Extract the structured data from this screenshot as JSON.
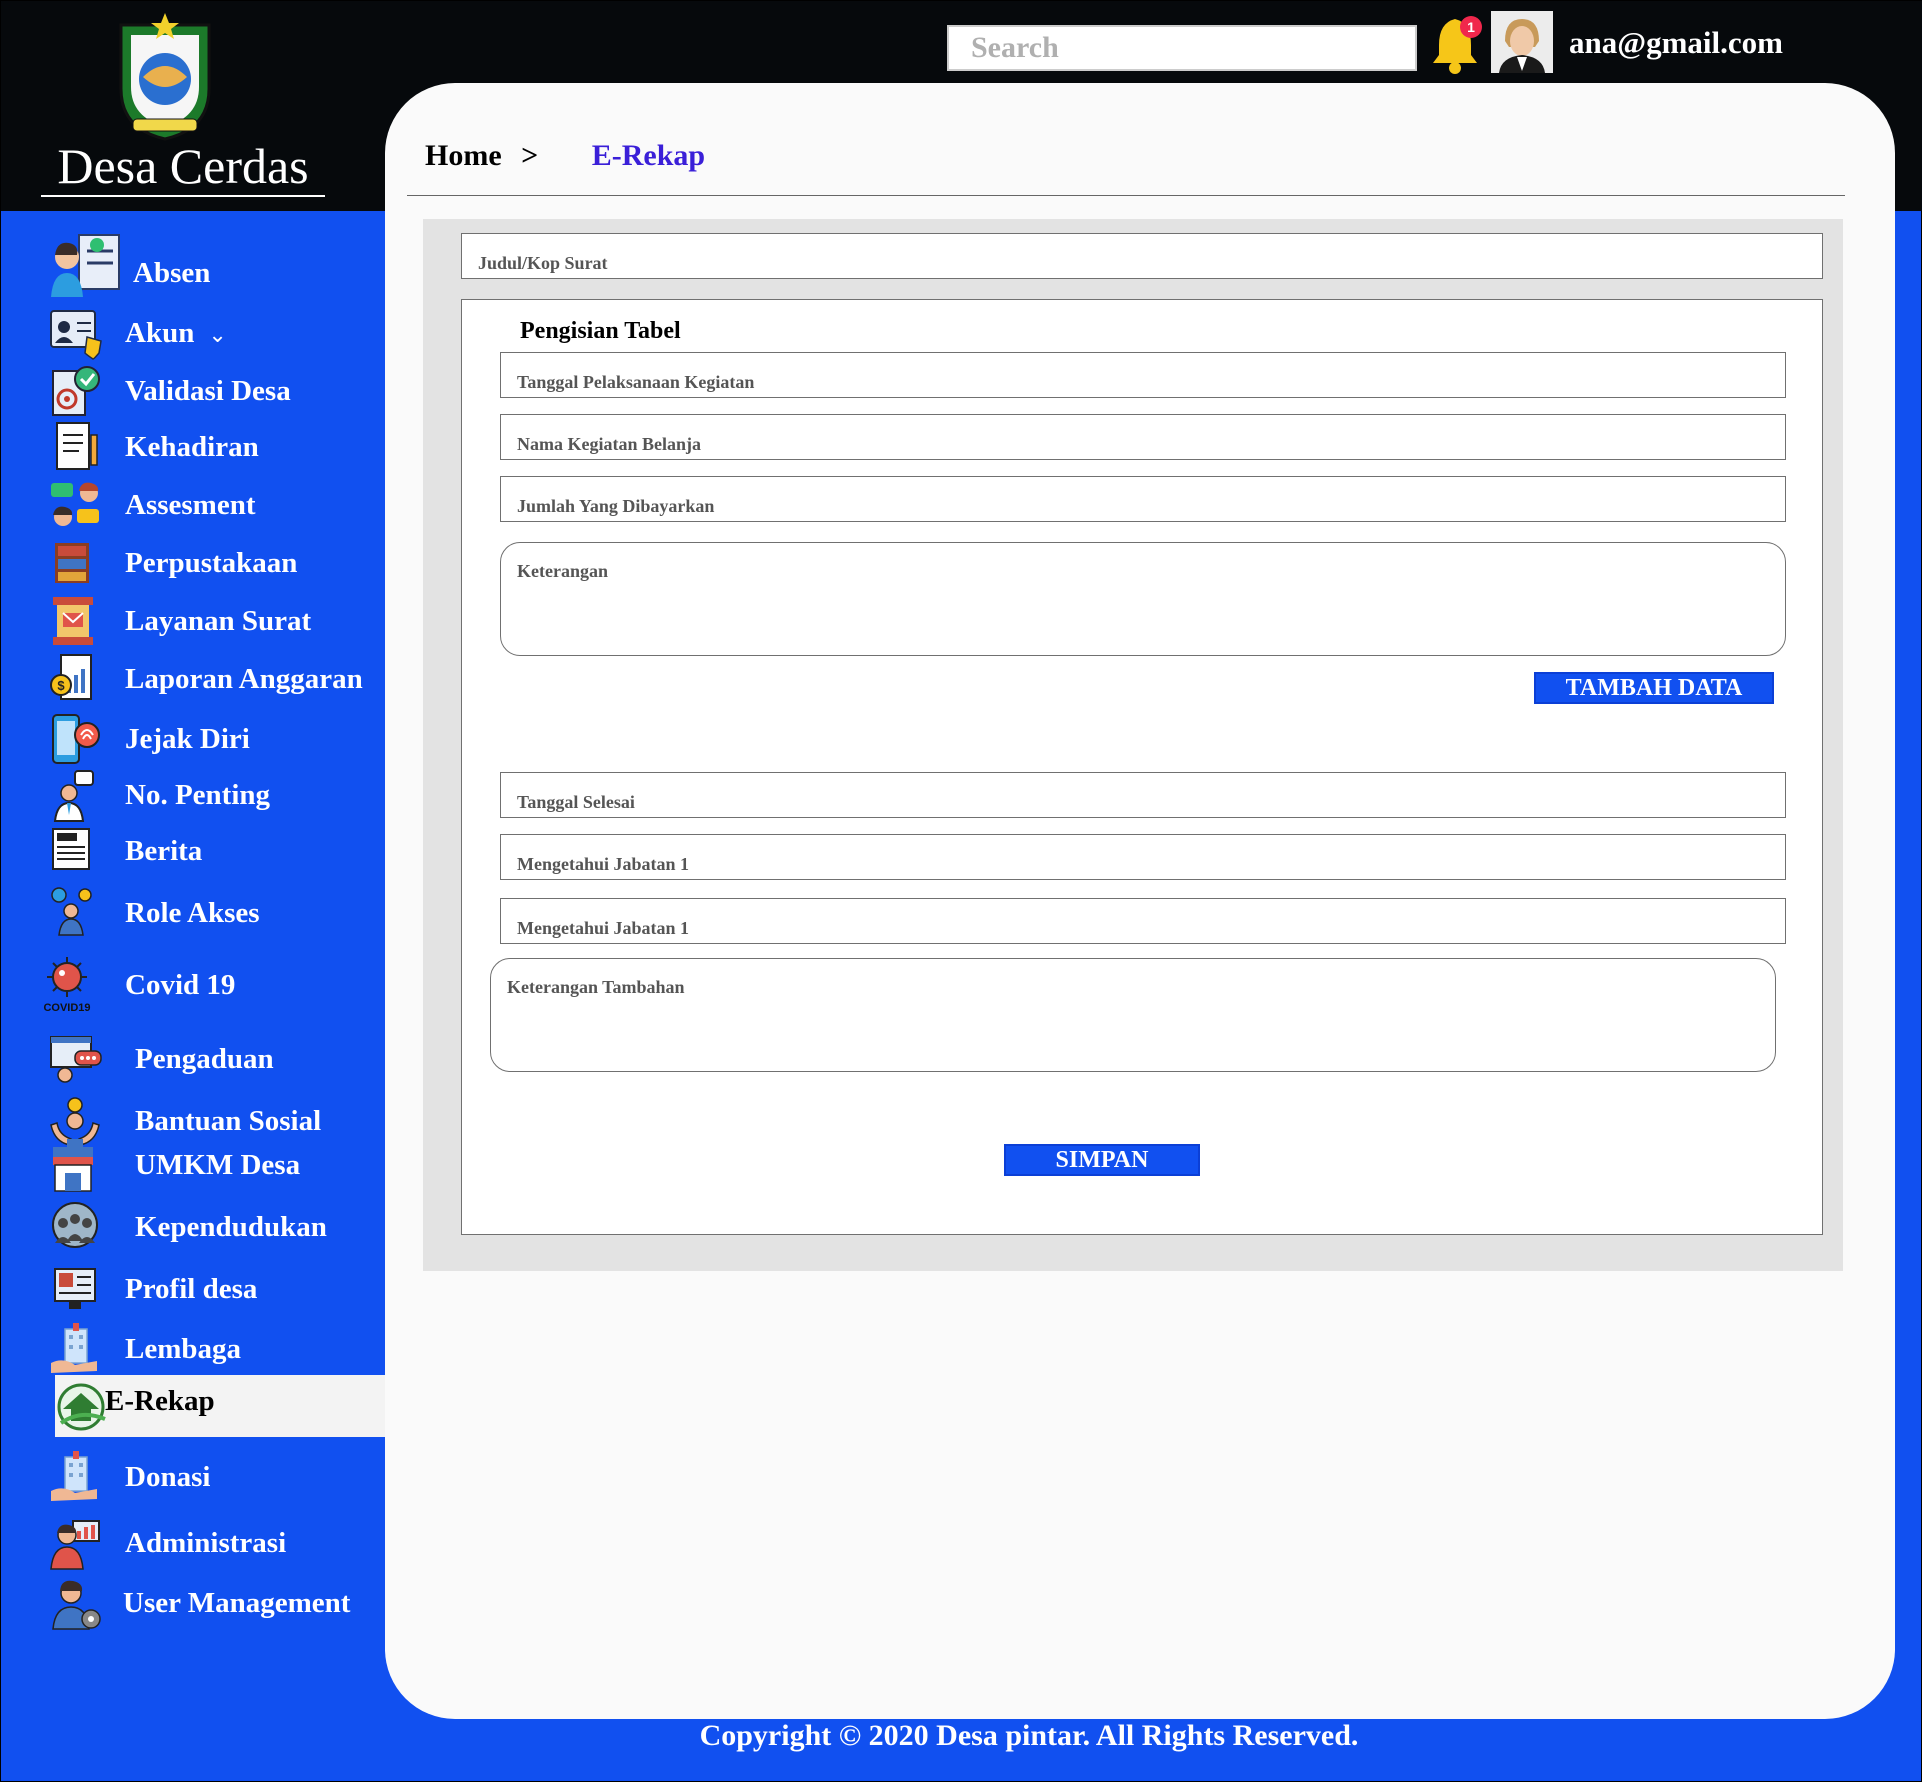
{
  "header": {
    "brand": "Desa Cerdas",
    "search_placeholder": "Search",
    "notification_count": "1",
    "user_email": "ana@gmail.com"
  },
  "sidebar": {
    "items": [
      {
        "label": "Absen",
        "icon": "attendance-icon"
      },
      {
        "label": "Akun",
        "icon": "account-icon",
        "chevron": "⌄"
      },
      {
        "label": "Validasi Desa",
        "icon": "validation-icon"
      },
      {
        "label": "Kehadiran",
        "icon": "document-icon"
      },
      {
        "label": "Assesment",
        "icon": "people-chat-icon"
      },
      {
        "label": "Perpustakaan",
        "icon": "bookshelf-icon"
      },
      {
        "label": "Layanan Surat",
        "icon": "mail-icon"
      },
      {
        "label": "Laporan Anggaran",
        "icon": "budget-report-icon"
      },
      {
        "label": "Jejak Diri",
        "icon": "fingerprint-phone-icon"
      },
      {
        "label": "No. Penting",
        "icon": "contact-icon"
      },
      {
        "label": "Berita",
        "icon": "news-icon"
      },
      {
        "label": "Role Akses",
        "icon": "role-settings-icon"
      },
      {
        "label": "Covid 19",
        "icon": "virus-icon",
        "badge": "COVID19"
      },
      {
        "label": "Pengaduan",
        "icon": "complaint-icon"
      },
      {
        "label": "Bantuan Sosial",
        "icon": "social-aid-icon"
      },
      {
        "label": "UMKM Desa",
        "icon": "shop-icon"
      },
      {
        "label": "Kependudukan",
        "icon": "population-icon"
      },
      {
        "label": "Profil desa",
        "icon": "village-profile-icon"
      },
      {
        "label": "Lembaga",
        "icon": "institution-icon"
      },
      {
        "label": "E-Rekap",
        "icon": "e-rekap-icon",
        "active": true
      },
      {
        "label": "Donasi",
        "icon": "donation-icon"
      },
      {
        "label": "Administrasi",
        "icon": "administration-icon"
      },
      {
        "label": "User Management",
        "icon": "user-management-icon"
      }
    ]
  },
  "breadcrumb": {
    "home": "Home",
    "separator": ">",
    "current": "E-Rekap"
  },
  "form": {
    "kop_surat_placeholder": "Judul/Kop Surat",
    "section_title": "Pengisian Tabel",
    "tanggal_pelaksanaan": "Tanggal Pelaksanaan Kegiatan",
    "nama_kegiatan": "Nama Kegiatan Belanja",
    "jumlah_dibayarkan": "Jumlah Yang Dibayarkan",
    "keterangan": "Keterangan",
    "tambah_button": "TAMBAH DATA",
    "tanggal_selesai": "Tanggal Selesai",
    "mengetahui_1": "Mengetahui Jabatan 1",
    "mengetahui_2": "Mengetahui Jabatan 1",
    "keterangan_tambahan": "Keterangan Tambahan",
    "simpan_button": "SIMPAN"
  },
  "footer": {
    "copyright": "Copyright © 2020 Desa pintar. All Rights Reserved."
  },
  "colors": {
    "primary": "#1150f0",
    "topbar": "#06090c",
    "content": "#fafafa",
    "breadcrumb_active": "#3a1fd8"
  }
}
